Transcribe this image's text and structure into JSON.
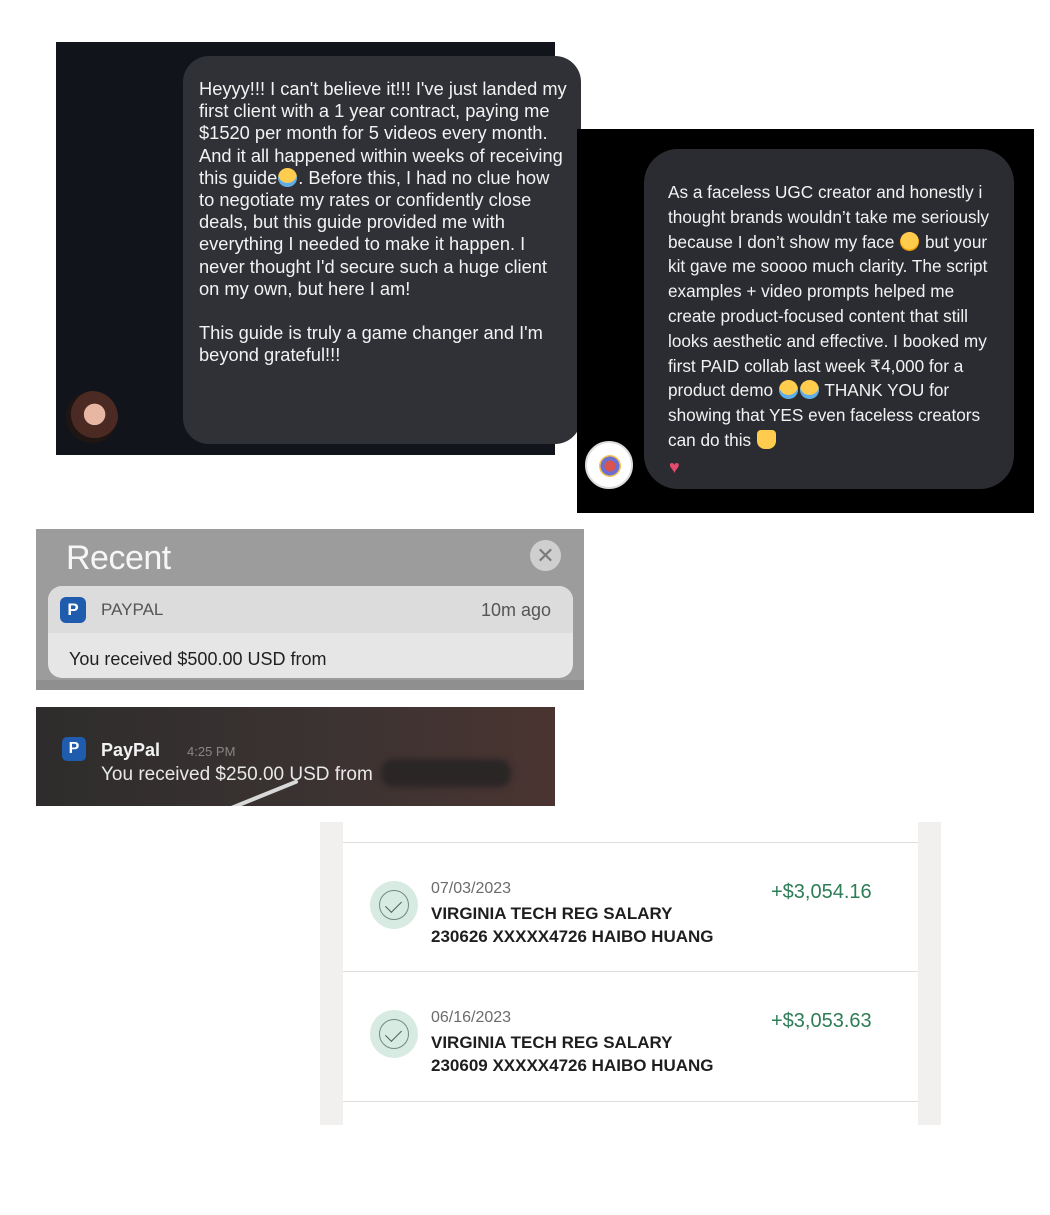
{
  "chat1": {
    "paragraphs": [
      "Heyyy!!! I can't believe it!!! I've just landed my first client with a 1 year contract, paying me $1520 per month for 5 videos every month. And it all happened within weeks of receiving this guide",
      ". Before this, I had no clue how to negotiate my rates or confidently close deals, but this guide provided me with everything I needed to make it happen. I never thought I'd secure such a huge client on my own, but here I am!",
      "This guide is truly a game changer and I'm beyond grateful!!!"
    ],
    "emoji": "crying-face"
  },
  "chat2": {
    "part1": "As a faceless UGC creator and honestly i thought brands wouldn’t take me seriously because I don’t show my face",
    "part2": "but your kit gave me soooo much clarity. The script examples + video prompts helped me create product-focused content that still looks aesthetic and effective. I booked my first PAID collab last week ₹4,000 for a product demo",
    "part3": "THANK YOU for showing that YES even faceless creators can do this",
    "heart": "♥"
  },
  "notification_center": {
    "heading": "Recent",
    "close_glyph": "✕",
    "notification": {
      "logo_letter": "P",
      "app": "PAYPAL",
      "time": "10m ago",
      "message": "You received $500.00 USD from"
    }
  },
  "lockscreen_notification": {
    "logo_letter": "P",
    "app": "PayPal",
    "time": "4:25 PM",
    "message": "You received $250.00 USD from"
  },
  "transactions": [
    {
      "date": "07/03/2023",
      "line1": "VIRGINIA TECH REG SALARY",
      "line2": "230626 XXXXX4726 HAIBO HUANG",
      "amount": "+$3,054.16"
    },
    {
      "date": "06/16/2023",
      "line1": "VIRGINIA TECH REG SALARY",
      "line2": "230609 XXXXX4726 HAIBO HUANG",
      "amount": "+$3,053.63"
    }
  ],
  "colors": {
    "amount_green": "#2e7d57",
    "paypal_blue": "#1f5cae",
    "check_bg": "#d8ebe3"
  }
}
